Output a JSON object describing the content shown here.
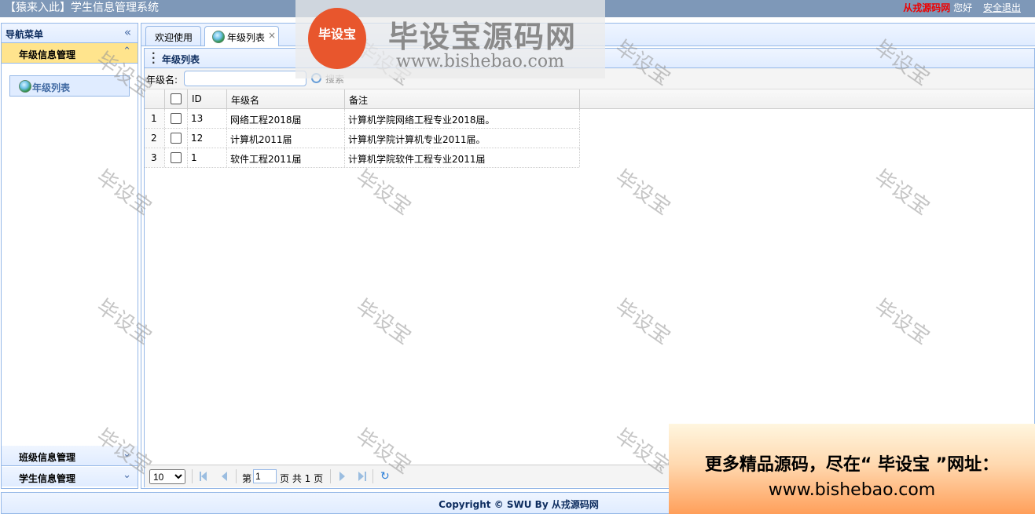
{
  "header": {
    "title": "【猿来入此】学生信息管理系统",
    "user": "从戎源码网",
    "hello": "您好",
    "logout": "安全退出"
  },
  "west": {
    "title": "导航菜单",
    "collapse_icon": "«",
    "sections": [
      {
        "label": "年级信息管理",
        "tool": "⌃"
      },
      {
        "label": "班级信息管理",
        "tool": "⌄"
      },
      {
        "label": "学生信息管理",
        "tool": "⌄"
      }
    ],
    "nav_item": "年级列表"
  },
  "tabs": [
    {
      "label": "欢迎使用"
    },
    {
      "label": "年级列表",
      "close": "×"
    }
  ],
  "panel": {
    "title": "年级列表",
    "search_label": "年级名:",
    "search_value": "",
    "search_button": "搜索"
  },
  "grid": {
    "columns": [
      "ID",
      "年级名",
      "备注"
    ],
    "rows": [
      {
        "num": "1",
        "id": "13",
        "name": "网络工程2018届",
        "note": "计算机学院网络工程专业2018届。"
      },
      {
        "num": "2",
        "id": "12",
        "name": "计算机2011届",
        "note": "计算机学院计算机专业2011届。"
      },
      {
        "num": "3",
        "id": "1",
        "name": "软件工程2011届",
        "note": "计算机学院软件工程专业2011届"
      }
    ]
  },
  "pager": {
    "page_size": "10",
    "before": "第",
    "page": "1",
    "after": "页 共 1 页",
    "refresh_icon": "↻"
  },
  "footer": {
    "text": "Copyright © SWU By 从戎源码网"
  },
  "watermark": {
    "text": "毕设宝",
    "brand": "毕设宝源码网",
    "brand_url": "www.bishebao.com",
    "logo_text": "毕设宝",
    "promo_line1": "更多精品源码，尽在“ 毕设宝 ”网址：",
    "promo_line2": "www.bishebao.com"
  },
  "colors": {
    "border": "#95b8e7",
    "selected": "#ffe48d",
    "topbar": "#7e98b8"
  }
}
